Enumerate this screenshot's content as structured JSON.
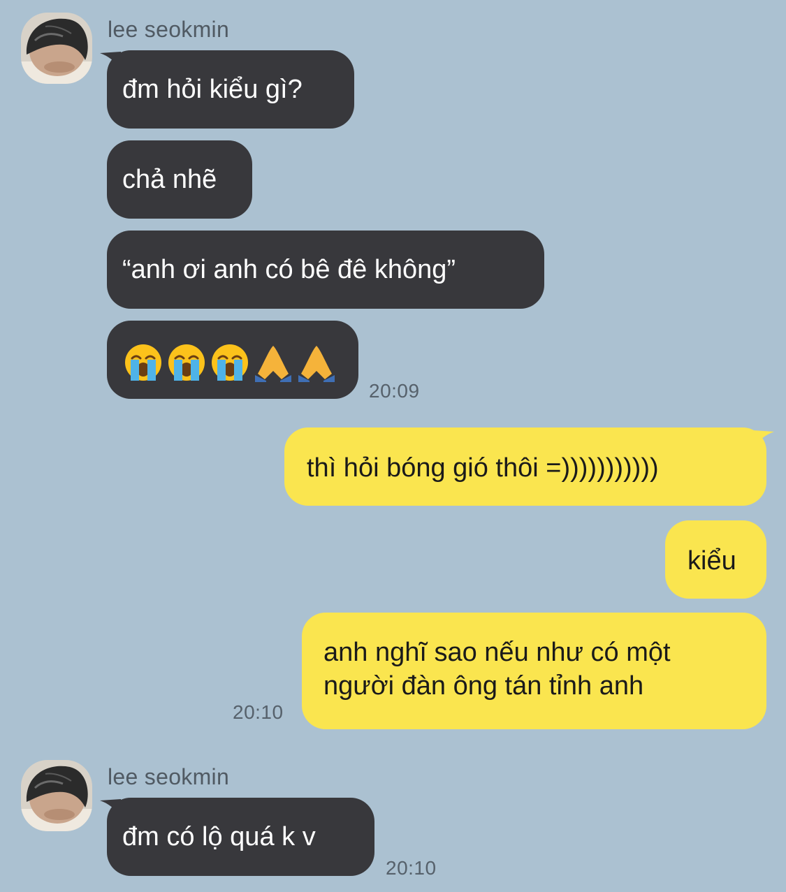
{
  "contact": {
    "name": "lee seokmin"
  },
  "messages": [
    {
      "from": "contact",
      "text": "đm hỏi kiểu gì?"
    },
    {
      "from": "contact",
      "text": "chả nhẽ"
    },
    {
      "from": "contact",
      "text": "“anh ơi anh có bê đê không”"
    },
    {
      "from": "contact",
      "emoji": [
        "loudly-crying-face",
        "loudly-crying-face",
        "loudly-crying-face",
        "folded-hands",
        "folded-hands"
      ],
      "time": "20:09"
    },
    {
      "from": "me",
      "text": "thì hỏi bóng gió thôi =)))))))))))"
    },
    {
      "from": "me",
      "text": "kiểu"
    },
    {
      "from": "me",
      "lines": [
        "anh nghĩ sao nếu như có một",
        "người đàn ông tán tỉnh anh"
      ],
      "time": "20:10"
    },
    {
      "from": "contact",
      "text": "đm có lộ quá k v",
      "time": "20:10"
    }
  ],
  "colors": {
    "background": "#abc1d1",
    "incoming_bubble": "#38383c",
    "outgoing_bubble": "#fae54f"
  }
}
